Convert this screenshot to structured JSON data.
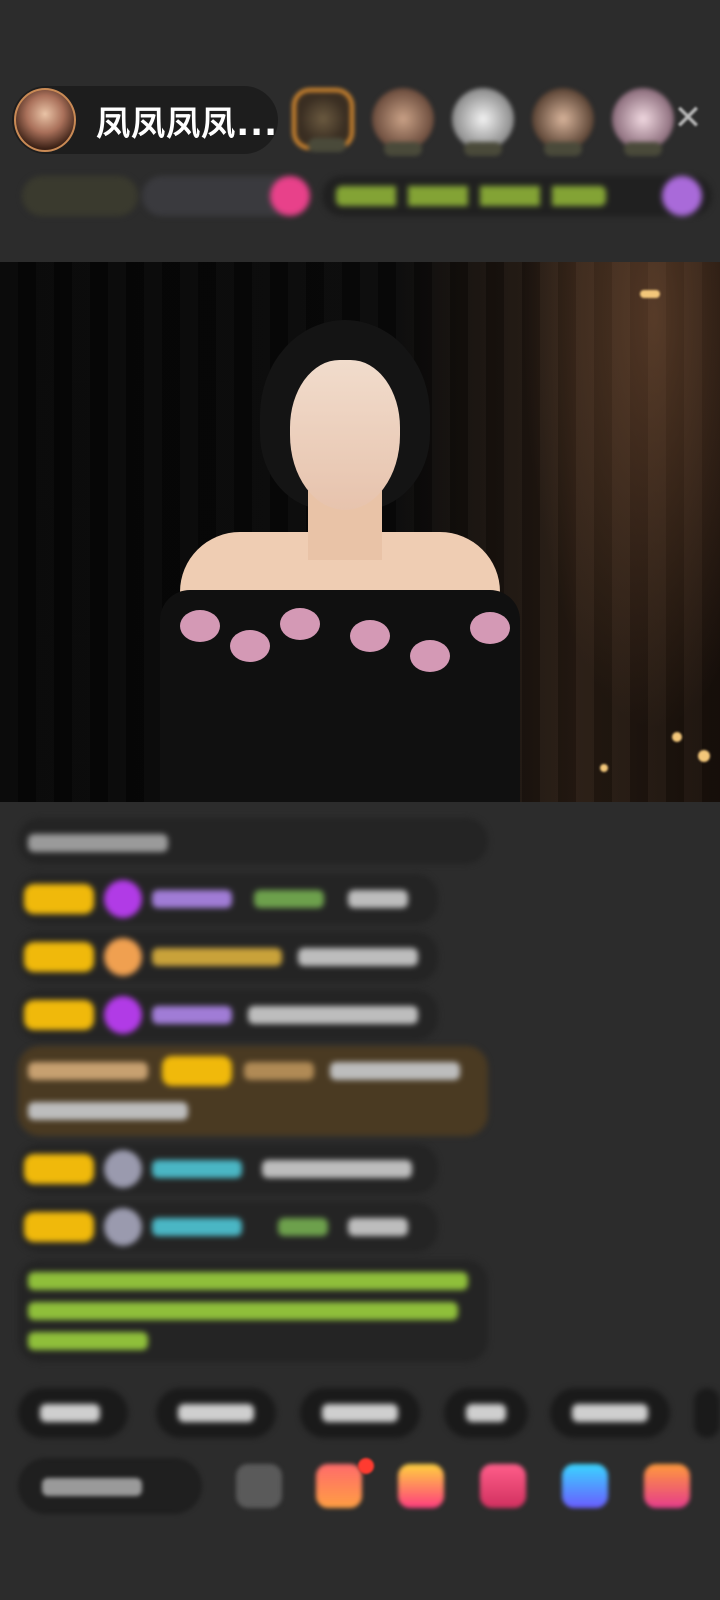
{
  "header": {
    "host_name": "凤凤凤凤...",
    "close_icon": "close-icon"
  },
  "icons": {
    "viewer_avatars": [
      "avatar-icon",
      "avatar-icon",
      "avatar-icon",
      "avatar-icon",
      "avatar-icon"
    ],
    "bottom_bar": [
      "emoji-icon",
      "gift-icon",
      "gift-icon",
      "heart-icon",
      "game-icon",
      "gift-box-icon"
    ]
  },
  "colors": {
    "level_badge": "#f0b90b",
    "notification_dot": "#ff3b30",
    "highlight_message_bg": "#4a3a22",
    "green_text": "#8fbf3a"
  }
}
